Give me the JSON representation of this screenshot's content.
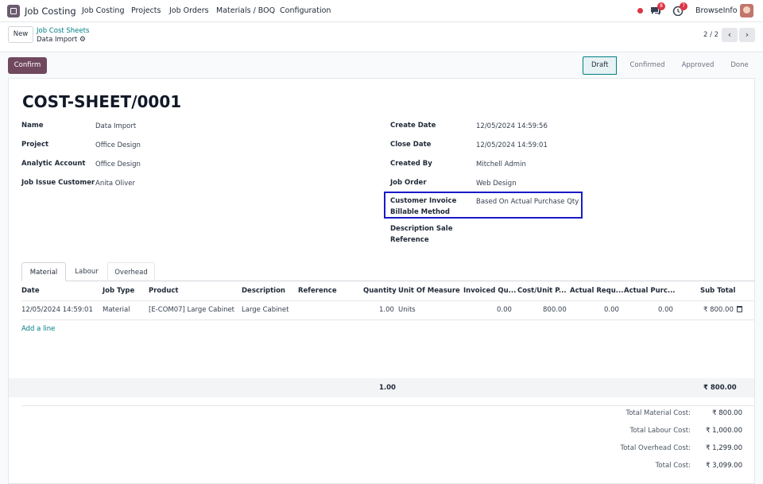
{
  "navbar": {
    "app_name": "Job Costing",
    "menu": [
      "Job Costing",
      "Projects",
      "Job Orders",
      "Materials / BOQ",
      "Configuration"
    ],
    "chat_badge": "8",
    "activity_badge": "7",
    "company": "BrowseInfo"
  },
  "control": {
    "new_label": "New",
    "breadcrumb_parent": "Job Cost Sheets",
    "breadcrumb_current": "Data Import",
    "pager": "2 / 2"
  },
  "status": {
    "confirm_label": "Confirm",
    "stages": [
      "Draft",
      "Confirmed",
      "Approved",
      "Done"
    ],
    "active_stage": "Draft"
  },
  "record": {
    "title": "COST-SHEET/0001",
    "left_fields": [
      {
        "label": "Name",
        "value": "Data Import"
      },
      {
        "label": "Project",
        "value": "Office Design"
      },
      {
        "label": "Analytic Account",
        "value": "Office Design"
      },
      {
        "label": "Job Issue Customer",
        "value": "Anita Oliver"
      }
    ],
    "right_fields": [
      {
        "label": "Create Date",
        "value": "12/05/2024 14:59:56"
      },
      {
        "label": "Close Date",
        "value": "12/05/2024 14:59:01"
      },
      {
        "label": "Created By",
        "value": "Mitchell Admin"
      },
      {
        "label": "Job Order",
        "value": "Web Design"
      }
    ],
    "billable_label_1": "Customer Invoice",
    "billable_label_2": "Billable Method",
    "billable_value": "Based On Actual Purchase Qty",
    "desc_label_1": "Description Sale",
    "desc_label_2": "Reference"
  },
  "tabs": [
    "Material",
    "Labour",
    "Overhead"
  ],
  "table": {
    "headers": [
      "Date",
      "Job Type",
      "Product",
      "Description",
      "Reference",
      "Quantity",
      "Unit Of Measure",
      "Invoiced Qu...",
      "Cost/Unit P...",
      "Actual Requ...",
      "Actual Purc...",
      "Sub Total"
    ],
    "rows": [
      [
        "12/05/2024 14:59:01",
        "Material",
        "[E-COM07] Large Cabinet",
        "Large Cabinet",
        "",
        "1.00",
        "Units",
        "0.00",
        "800.00",
        "0.00",
        "0.00",
        "₹ 800.00"
      ]
    ],
    "add_line": "Add a line",
    "footer_quantity": "1.00",
    "footer_subtotal": "₹ 800.00"
  },
  "totals": [
    {
      "label": "Total Material Cost:",
      "value": "₹ 800.00"
    },
    {
      "label": "Total Labour Cost:",
      "value": "₹ 1,000.00"
    },
    {
      "label": "Total Overhead Cost:",
      "value": "₹ 1,299.00"
    },
    {
      "label": "Total Cost:",
      "value": "₹ 3,099.00"
    }
  ],
  "colors": {
    "primary": "#71495f",
    "link": "#017e84",
    "highlight": "#1a1ac8"
  }
}
